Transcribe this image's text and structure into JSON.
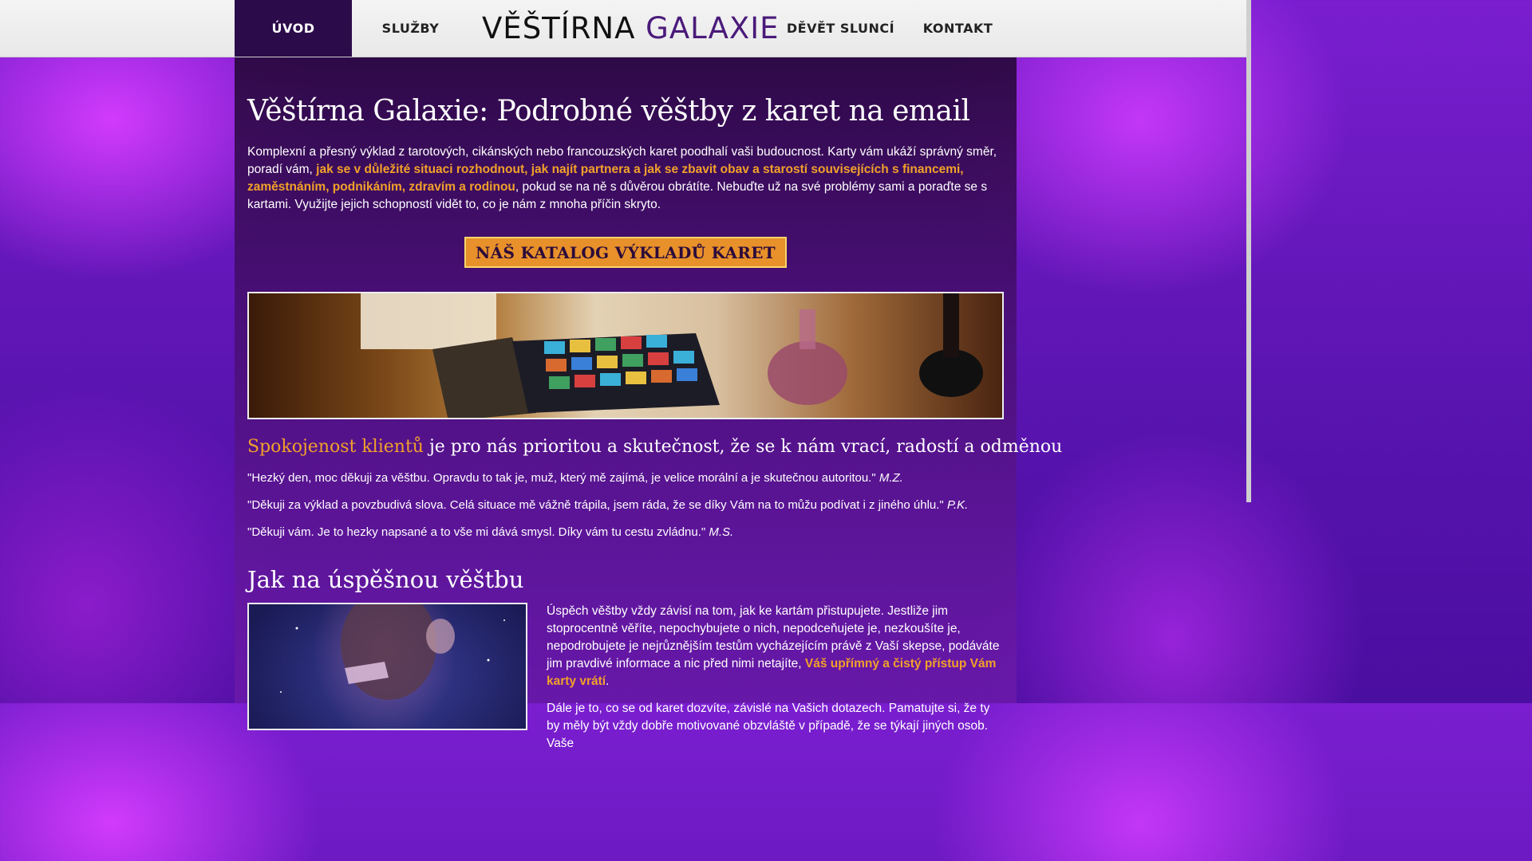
{
  "nav": {
    "items": [
      "ÚVOD",
      "SLUŽBY",
      "DĚVĚT SLUNCÍ",
      "KONTAKT"
    ],
    "logo_text_a": "VĚŠTÍRNA",
    "logo_text_b": "GALAXIE"
  },
  "main": {
    "title": "Věštírna Galaxie: Podrobné věštby z karet na email",
    "intro_a": "Komplexní a přesný výklad z tarotových, cikánských nebo francouzských karet poodhalí vaši budoucnost. Karty vám ukáží správný směr, poradí vám, ",
    "intro_hl": "jak se v důležité situaci rozhodnout, jak najít partnera a jak se zbavit obav a starostí souvisejících s financemi, zaměstnáním, podnikáním, zdravím a rodinou",
    "intro_b": ", pokud se na ně s důvěrou obrátíte. Nebuďte už na své problémy sami a poraďte se s kartami. Využijte jejich schopností vidět to, co je nám z mnoha příčin skryto.",
    "cta": "NÁŠ KATALOG VÝKLADŮ KARET",
    "sat_lead": "Spokojenost klientů",
    "sat_rest": " je pro nás prioritou a skutečnost, že se k nám vrací, radostí a odměnou",
    "testimonials": [
      {
        "text": "\"Hezký den, moc děkuji za věštbu. Opravdu to tak je, muž, který mě zajímá, je velice morální a je skutečnou autoritou.\"",
        "author": "M.Z."
      },
      {
        "text": "\"Děkuji za výklad a povzbudivá slova. Celá situace mě vážně trápila, jsem ráda, že se díky Vám na to můžu podívat i z jiného úhlu.\"",
        "author": "P.K."
      },
      {
        "text": "\"Děkuji vám. Je to hezky napsané a to vše mi dává smysl. Díky vám tu cestu zvládnu.\"",
        "author": "M.S."
      }
    ],
    "section_title": "Jak na úspěšnou věštbu",
    "p1_a": "Úspěch věštby vždy závisí na tom, jak ke kartám přistupujete. Jestliže jim stoprocentně věříte, nepochybujete o nich, nepodceňujete je, nezkoušíte je, nepodrobujete je nejrůznějším testům vycházejícím právě z Vaší skepse, podáváte jim pravdivé informace a nic před nimi netajíte, ",
    "p1_hl": "Váš upřímný a čistý přístup Vám karty vrátí",
    "p1_b": ".",
    "p2": "Dále je to, co se od karet dozvíte, závislé na Vašich dotazech. Pamatujte si, že ty by měly být vždy dobře motivované obzvláště v případě, že se týkají jiných osob. Vaše"
  },
  "colors": {
    "accent": "#f2a12a",
    "nav_active": "#2b0b4a",
    "cta_bg": "#e8902a"
  },
  "icons": {
    "logo": "purple-crystal-icon"
  }
}
